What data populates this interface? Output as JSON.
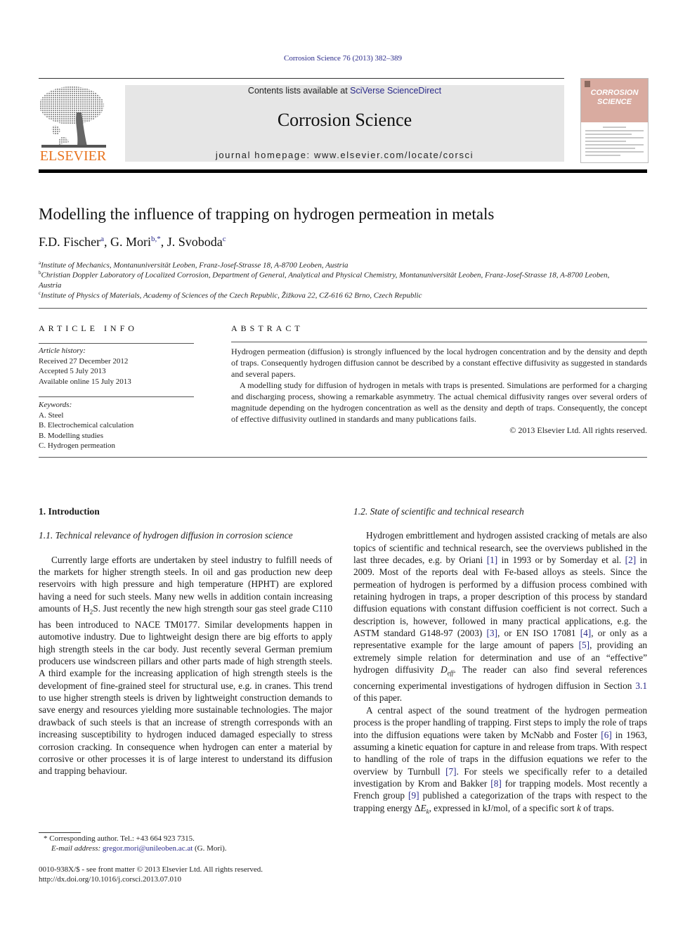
{
  "citation": "Corrosion Science 76 (2013) 382–389",
  "masthead": {
    "publisher": "ELSEVIER",
    "contents_prefix": "Contents lists available at ",
    "contents_link": "SciVerse ScienceDirect",
    "journal_name": "Corrosion Science",
    "homepage": "journal homepage: www.elsevier.com/locate/corsci",
    "cover_title_line1": "CORROSION",
    "cover_title_line2": "SCIENCE"
  },
  "colors": {
    "link": "#2a2a8a",
    "elsevier_orange": "#e8731e",
    "header_bg": "#e6e6e6",
    "cover_pink": "#d9aba0"
  },
  "article": {
    "title": "Modelling the influence of trapping on hydrogen permeation in metals",
    "authors": [
      {
        "name": "F.D. Fischer",
        "sup": "a"
      },
      {
        "name": "G. Mori",
        "sup": "b,*"
      },
      {
        "name": "J. Svoboda",
        "sup": "c"
      }
    ],
    "affiliations": [
      {
        "sup": "a",
        "text": "Institute of Mechanics, Montanuniversität Leoben, Franz-Josef-Strasse 18, A-8700 Leoben, Austria"
      },
      {
        "sup": "b",
        "text": "Christian Doppler Laboratory of Localized Corrosion, Department of General, Analytical and Physical Chemistry, Montanuniversität Leoben, Franz-Josef-Strasse 18, A-8700 Leoben, Austria"
      },
      {
        "sup": "c",
        "text": "Institute of Physics of Materials, Academy of Sciences of the Czech Republic, Žižkova 22, CZ-616 62 Brno, Czech Republic"
      }
    ]
  },
  "article_info": {
    "heading": "ARTICLE INFO",
    "history_label": "Article history:",
    "history": [
      "Received 27 December 2012",
      "Accepted 5 July 2013",
      "Available online 15 July 2013"
    ],
    "keywords_label": "Keywords:",
    "keywords": [
      "A. Steel",
      "B. Electrochemical calculation",
      "B. Modelling studies",
      "C. Hydrogen permeation"
    ]
  },
  "abstract": {
    "heading": "ABSTRACT",
    "paragraphs": [
      "Hydrogen permeation (diffusion) is strongly influenced by the local hydrogen concentration and by the density and depth of traps. Consequently hydrogen diffusion cannot be described by a constant effective diffusivity as suggested in standards and several papers.",
      "A modelling study for diffusion of hydrogen in metals with traps is presented. Simulations are performed for a charging and discharging process, showing a remarkable asymmetry. The actual chemical diffusivity ranges over several orders of magnitude depending on the hydrogen concentration as well as the density and depth of traps. Consequently, the concept of effective diffusivity outlined in standards and many publications fails."
    ],
    "copyright": "© 2013 Elsevier Ltd. All rights reserved."
  },
  "body": {
    "section1_heading": "1. Introduction",
    "subsection11_heading": "1.1. Technical relevance of hydrogen diffusion in corrosion science",
    "para11_a": "Currently large efforts are undertaken by steel industry to fulfill needs of the markets for higher strength steels. In oil and gas production new deep reservoirs with high pressure and high temperature (HPHT) are explored having a need for such steels. Many new wells in addition contain increasing amounts of H",
    "para11_sub": "2",
    "para11_b": "S. Just recently the new high strength sour gas steel grade C110 has been introduced to NACE TM0177. Similar developments happen in automotive industry. Due to lightweight design there are big efforts to apply high strength steels in the car body. Just recently several German premium producers use windscreen pillars and other parts made of high strength steels. A third example for the increasing application of high strength steels is the development of fine-grained steel for structural use, e.g. in cranes. This trend to use higher strength steels is driven by lightweight construction demands to save energy and resources yielding more sustainable technologies. The major drawback of such steels is that an increase of strength corresponds with an increasing susceptibility to hydrogen induced damaged especially to stress corrosion cracking. In consequence when hydrogen can enter a material by corrosive or other processes it is of large interest to understand its diffusion and trapping behaviour.",
    "subsection12_heading": "1.2. State of scientific and technical research",
    "para12a": [
      "Hydrogen embrittlement and hydrogen assisted cracking of metals are also topics of scientific and technical research, see the overviews published in the last three decades, e.g. by Oriani ",
      "[1]",
      " in 1993 or by Somerday et al. ",
      "[2]",
      " in 2009. Most of the reports deal with Fe-based alloys as steels. Since the permeation of hydrogen is performed by a diffusion process combined with retaining hydrogen in traps, a proper description of this process by standard diffusion equations with constant diffusion coefficient is not correct. Such a description is, however, followed in many practical applications, e.g. the ASTM standard G148-97 (2003) ",
      "[3]",
      ", or EN ISO 17081 ",
      "[4]",
      ", or only as a representative example for the large amount of papers ",
      "[5]",
      ", providing an extremely simple relation for determination and use of an “effective” hydrogen diffusivity ",
      "D",
      "eff",
      ". The reader can also find several references concerning experimental investigations of hydrogen diffusion in Section ",
      "3.1",
      " of this paper."
    ],
    "para12b": [
      "A central aspect of the sound treatment of the hydrogen permeation process is the proper handling of trapping. First steps to imply the role of traps into the diffusion equations were taken by McNabb and Foster ",
      "[6]",
      " in 1963, assuming a kinetic equation for capture in and release from traps. With respect to handling of the role of traps in the diffusion equations we refer to the overview by Turnbull ",
      "[7]",
      ". For steels we specifically refer to a detailed investigation by Krom and Bakker ",
      "[8]",
      " for trapping models. Most recently a French group ",
      "[9]",
      " published a categorization of the traps with respect to the trapping energy Δ",
      "E",
      "k",
      ", expressed in kJ/mol, of a specific sort ",
      "k",
      " of traps."
    ]
  },
  "footnotes": {
    "corresponding": "* Corresponding author. Tel.: +43 664 923 7315.",
    "email_label": "E-mail address: ",
    "email": "gregor.mori@unileoben.ac.at",
    "email_suffix": " (G. Mori).",
    "front_matter": "0010-938X/$ - see front matter © 2013 Elsevier Ltd. All rights reserved.",
    "doi": "http://dx.doi.org/10.1016/j.corsci.2013.07.010"
  }
}
